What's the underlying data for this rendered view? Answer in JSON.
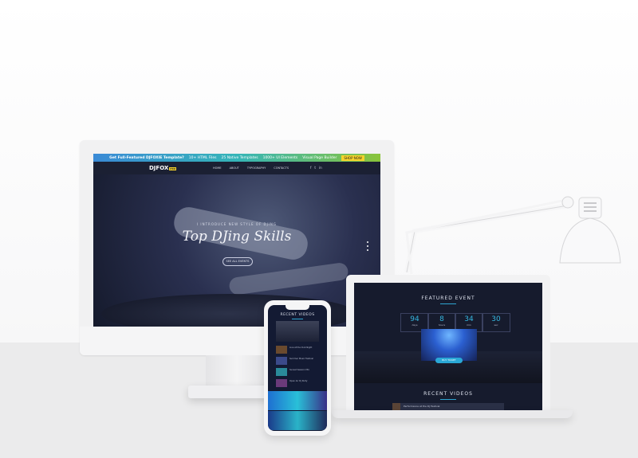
{
  "desktop": {
    "promo": {
      "text": "Get Full-Featured DJFOXIE Template?",
      "items": [
        "10+ HTML Files",
        "25 Native Templates",
        "1000+ UI Elements",
        "Visual Page Builder"
      ],
      "button": "SHOP NOW"
    },
    "logo": "DJFOX",
    "logo_badge": "PRO",
    "menu": [
      "HOME",
      "ABOUT",
      "TYPOGRAPHY",
      "CONTACTS"
    ],
    "social": [
      "f",
      "t",
      "in"
    ],
    "hero": {
      "subtitle": "I INTRODUCE NEW STYLE OF DJING",
      "title": "Top DJing Skills",
      "button": "SEE ALL EVENTS"
    }
  },
  "laptop": {
    "featured_title": "FEATURED EVENT",
    "countdown": [
      {
        "value": "94",
        "label": "days"
      },
      {
        "value": "8",
        "label": "hours"
      },
      {
        "value": "34",
        "label": "min"
      },
      {
        "value": "30",
        "label": "sec"
      }
    ],
    "event_button": "BUY TICKET",
    "recent_title": "RECENT VIDEOS",
    "recent_item": "Performance at the DJ Festival"
  },
  "phone": {
    "title": "RECENT VIDEOS",
    "items": [
      "Live at the Club Night",
      "Summer Music Festival",
      "Sunset Session Mix",
      "Open Air DJ Party"
    ]
  }
}
